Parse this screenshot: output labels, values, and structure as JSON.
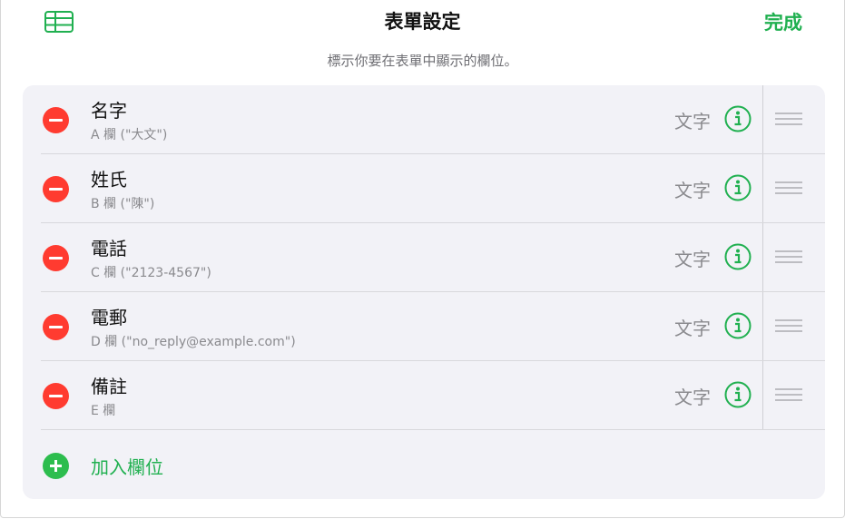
{
  "header": {
    "table_icon": "table-grid-icon",
    "title": "表單設定",
    "done_label": "完成",
    "subtitle": "標示你要在表單中顯示的欄位。"
  },
  "fields": [
    {
      "name": "名字",
      "column": "A 欄 (\"大文\")",
      "type": "文字"
    },
    {
      "name": "姓氏",
      "column": "B 欄 (\"陳\")",
      "type": "文字"
    },
    {
      "name": "電話",
      "column": "C 欄 (\"2123-4567\")",
      "type": "文字"
    },
    {
      "name": "電郵",
      "column": "D 欄 (\"no_reply@example.com\")",
      "type": "文字"
    },
    {
      "name": "備註",
      "column": "E 欄",
      "type": "文字"
    }
  ],
  "add_field": {
    "label": "加入欄位",
    "icon": "plus-circle-icon"
  },
  "colors": {
    "accent_green": "#20b050",
    "remove_red": "#ff3b30",
    "card_bg": "#f2f2f7"
  }
}
